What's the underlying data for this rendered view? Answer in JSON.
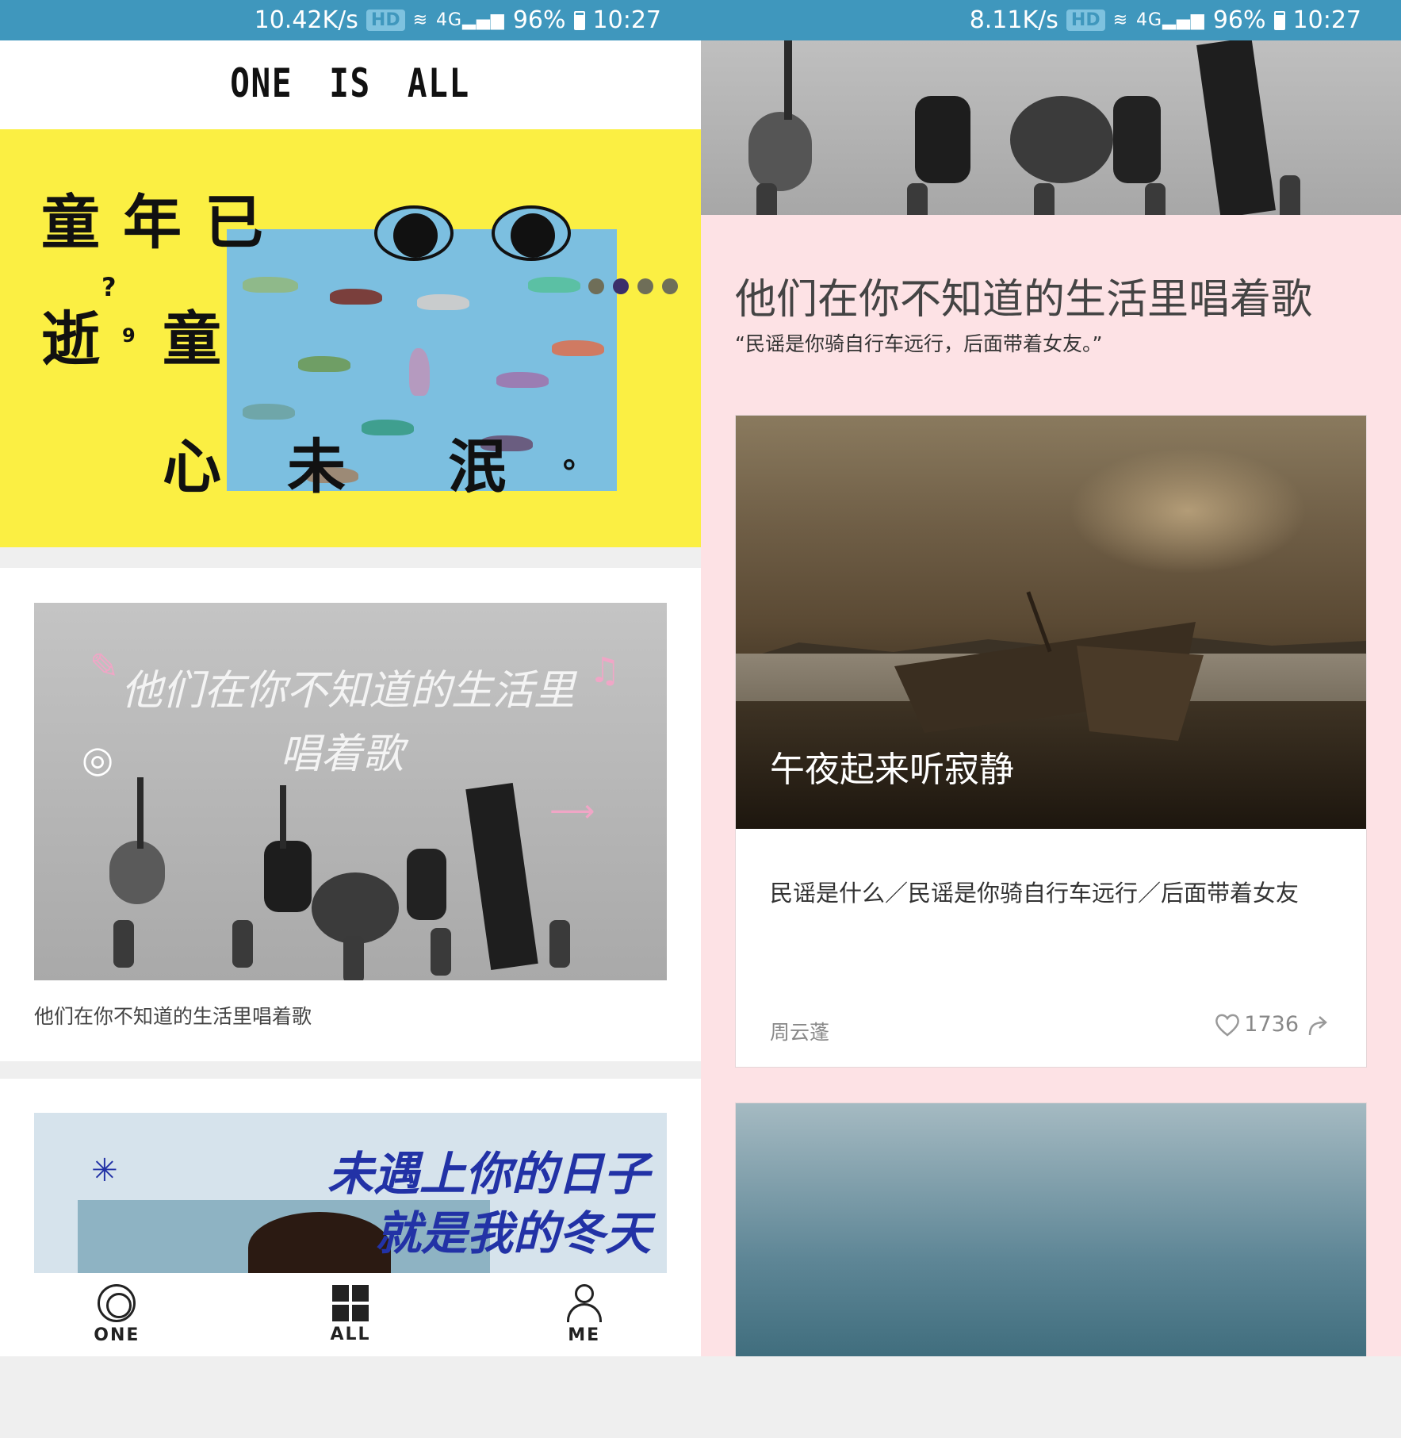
{
  "left_screen": {
    "status_bar": {
      "speed": "10.42K/s",
      "hd": "HD",
      "network": "4G",
      "battery": "96%",
      "time": "10:27"
    },
    "header": {
      "title": "ONE IS ALL"
    },
    "banner": {
      "text_chars": [
        "童",
        "年",
        "已",
        "逝",
        "?",
        "9",
        "童",
        "心",
        "未",
        "泯",
        "。"
      ],
      "dots_count": 4,
      "active_dot": 2
    },
    "cards": [
      {
        "image_text_line1": "他们在你不知道的生活里",
        "image_text_line2": "唱着歌",
        "caption": "他们在你不知道的生活里唱着歌"
      },
      {
        "image_text_line1": "未遇上你的日子",
        "image_text_line2": "就是我的冬天"
      }
    ],
    "tabbar": {
      "one": "ONE",
      "all": "ALL",
      "me": "ME"
    }
  },
  "right_screen": {
    "status_bar": {
      "speed": "8.11K/s",
      "hd": "HD",
      "network": "4G",
      "battery": "96%",
      "time": "10:27"
    },
    "title": "他们在你不知道的生活里唱着歌",
    "quote": "“民谣是你骑自行车远行，后面带着女友。”",
    "article": {
      "photo_title": "午夜起来听寂静",
      "excerpt": "民谣是什么／民谣是你骑自行车远行／后面带着女友",
      "author": "周云蓬",
      "likes": "1736"
    }
  },
  "colors": {
    "status_bar": "#3f97bd",
    "banner_yellow": "#fbef43",
    "banner_photo_blue": "#7cbfe0",
    "right_background": "#fde2e5",
    "winter_text_blue": "#2232a6",
    "active_dot": "#3b2f6a"
  },
  "icons": [
    "wifi-icon",
    "signal-icon",
    "battery-icon",
    "one-tab-icon",
    "all-tab-icon",
    "me-tab-icon",
    "heart-icon",
    "share-icon"
  ]
}
